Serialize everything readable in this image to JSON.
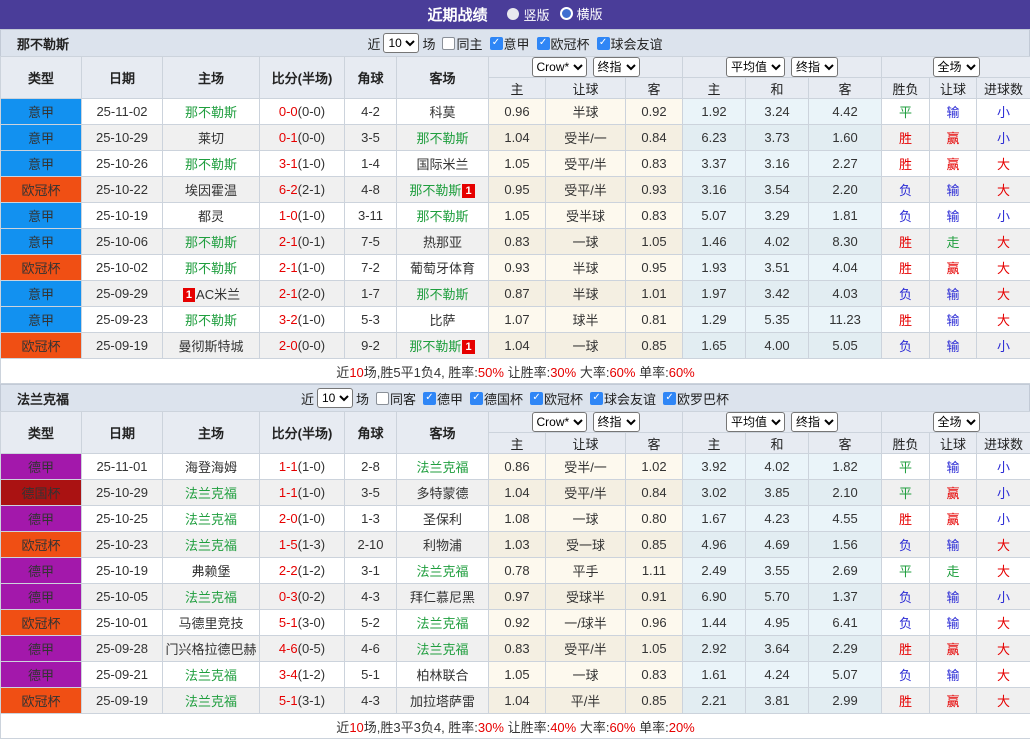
{
  "title_bar": {
    "title": "近期战绩",
    "options": [
      {
        "label": "竖版",
        "selected": true
      },
      {
        "label": "横版",
        "selected": false
      }
    ]
  },
  "league_colors": {
    "意甲": "#1291f0",
    "欧冠杯": "#f04f14",
    "德甲": "#a318ab",
    "德国杯": "#aa1212"
  },
  "result_colors": {
    "r": "#e60000",
    "b": "#2b2bd5",
    "g": "#1f9e3e",
    "d": "#333333"
  },
  "table_header": {
    "static_cols": [
      "类型",
      "日期",
      "主场",
      "比分(半场)",
      "角球",
      "客场"
    ],
    "group1": {
      "select1": "Crow*",
      "select2": "终指"
    },
    "group2": {
      "select1": "平均值",
      "select2": "终指"
    },
    "group3": {
      "select": "全场"
    },
    "sub_cols": [
      "主",
      "让球",
      "客",
      "主",
      "和",
      "客",
      "胜负",
      "让球",
      "进球数"
    ]
  },
  "sections": [
    {
      "team": "那不勒斯",
      "filter": {
        "prefix": "近",
        "games": "10",
        "suffix": "场",
        "same": {
          "label": "同主",
          "checked": false
        },
        "leagues": [
          {
            "label": "意甲",
            "checked": true
          },
          {
            "label": "欧冠杯",
            "checked": true
          },
          {
            "label": "球会友谊",
            "checked": true
          }
        ]
      },
      "rows": [
        {
          "type": "意甲",
          "date": "25-11-02",
          "home": "那不勒斯",
          "home_hl": true,
          "home_badge": "",
          "score": "0-0",
          "half": "(0-0)",
          "corner": "4-2",
          "away": "科莫",
          "away_hl": false,
          "away_badge": "",
          "o1": "0.96",
          "o2": "半球",
          "o3": "0.92",
          "a1": "1.92",
          "a2": "3.24",
          "a3": "4.42",
          "r1": {
            "t": "平",
            "c": "g"
          },
          "r2": {
            "t": "输",
            "c": "b"
          },
          "r3": {
            "t": "小",
            "c": "b"
          }
        },
        {
          "type": "意甲",
          "date": "25-10-29",
          "home": "莱切",
          "home_hl": false,
          "home_badge": "",
          "score": "0-1",
          "half": "(0-0)",
          "corner": "3-5",
          "away": "那不勒斯",
          "away_hl": true,
          "away_badge": "",
          "o1": "1.04",
          "o2": "受半/一",
          "o3": "0.84",
          "a1": "6.23",
          "a2": "3.73",
          "a3": "1.60",
          "r1": {
            "t": "胜",
            "c": "r"
          },
          "r2": {
            "t": "赢",
            "c": "r"
          },
          "r3": {
            "t": "小",
            "c": "b"
          }
        },
        {
          "type": "意甲",
          "date": "25-10-26",
          "home": "那不勒斯",
          "home_hl": true,
          "home_badge": "",
          "score": "3-1",
          "half": "(1-0)",
          "corner": "1-4",
          "away": "国际米兰",
          "away_hl": false,
          "away_badge": "",
          "o1": "1.05",
          "o2": "受平/半",
          "o3": "0.83",
          "a1": "3.37",
          "a2": "3.16",
          "a3": "2.27",
          "r1": {
            "t": "胜",
            "c": "r"
          },
          "r2": {
            "t": "赢",
            "c": "r"
          },
          "r3": {
            "t": "大",
            "c": "r"
          }
        },
        {
          "type": "欧冠杯",
          "date": "25-10-22",
          "home": "埃因霍温",
          "home_hl": false,
          "home_badge": "",
          "score": "6-2",
          "half": "(2-1)",
          "corner": "4-8",
          "away": "那不勒斯",
          "away_hl": true,
          "away_badge": "1",
          "o1": "0.95",
          "o2": "受平/半",
          "o3": "0.93",
          "a1": "3.16",
          "a2": "3.54",
          "a3": "2.20",
          "r1": {
            "t": "负",
            "c": "b"
          },
          "r2": {
            "t": "输",
            "c": "b"
          },
          "r3": {
            "t": "大",
            "c": "r"
          }
        },
        {
          "type": "意甲",
          "date": "25-10-19",
          "home": "都灵",
          "home_hl": false,
          "home_badge": "",
          "score": "1-0",
          "half": "(1-0)",
          "corner": "3-11",
          "away": "那不勒斯",
          "away_hl": true,
          "away_badge": "",
          "o1": "1.05",
          "o2": "受半球",
          "o3": "0.83",
          "a1": "5.07",
          "a2": "3.29",
          "a3": "1.81",
          "r1": {
            "t": "负",
            "c": "b"
          },
          "r2": {
            "t": "输",
            "c": "b"
          },
          "r3": {
            "t": "小",
            "c": "b"
          }
        },
        {
          "type": "意甲",
          "date": "25-10-06",
          "home": "那不勒斯",
          "home_hl": true,
          "home_badge": "",
          "score": "2-1",
          "half": "(0-1)",
          "corner": "7-5",
          "away": "热那亚",
          "away_hl": false,
          "away_badge": "",
          "o1": "0.83",
          "o2": "一球",
          "o3": "1.05",
          "a1": "1.46",
          "a2": "4.02",
          "a3": "8.30",
          "r1": {
            "t": "胜",
            "c": "r"
          },
          "r2": {
            "t": "走",
            "c": "g"
          },
          "r3": {
            "t": "大",
            "c": "r"
          }
        },
        {
          "type": "欧冠杯",
          "date": "25-10-02",
          "home": "那不勒斯",
          "home_hl": true,
          "home_badge": "",
          "score": "2-1",
          "half": "(1-0)",
          "corner": "7-2",
          "away": "葡萄牙体育",
          "away_hl": false,
          "away_badge": "",
          "o1": "0.93",
          "o2": "半球",
          "o3": "0.95",
          "a1": "1.93",
          "a2": "3.51",
          "a3": "4.04",
          "r1": {
            "t": "胜",
            "c": "r"
          },
          "r2": {
            "t": "赢",
            "c": "r"
          },
          "r3": {
            "t": "大",
            "c": "r"
          }
        },
        {
          "type": "意甲",
          "date": "25-09-29",
          "home": "AC米兰",
          "home_hl": false,
          "home_badge": "1",
          "score": "2-1",
          "half": "(2-0)",
          "corner": "1-7",
          "away": "那不勒斯",
          "away_hl": true,
          "away_badge": "",
          "o1": "0.87",
          "o2": "半球",
          "o3": "1.01",
          "a1": "1.97",
          "a2": "3.42",
          "a3": "4.03",
          "r1": {
            "t": "负",
            "c": "b"
          },
          "r2": {
            "t": "输",
            "c": "b"
          },
          "r3": {
            "t": "大",
            "c": "r"
          }
        },
        {
          "type": "意甲",
          "date": "25-09-23",
          "home": "那不勒斯",
          "home_hl": true,
          "home_badge": "",
          "score": "3-2",
          "half": "(1-0)",
          "corner": "5-3",
          "away": "比萨",
          "away_hl": false,
          "away_badge": "",
          "o1": "1.07",
          "o2": "球半",
          "o3": "0.81",
          "a1": "1.29",
          "a2": "5.35",
          "a3": "11.23",
          "r1": {
            "t": "胜",
            "c": "r"
          },
          "r2": {
            "t": "输",
            "c": "b"
          },
          "r3": {
            "t": "大",
            "c": "r"
          }
        },
        {
          "type": "欧冠杯",
          "date": "25-09-19",
          "home": "曼彻斯特城",
          "home_hl": false,
          "home_badge": "",
          "score": "2-0",
          "half": "(0-0)",
          "corner": "9-2",
          "away": "那不勒斯",
          "away_hl": true,
          "away_badge": "1",
          "o1": "1.04",
          "o2": "一球",
          "o3": "0.85",
          "a1": "1.65",
          "a2": "4.00",
          "a3": "5.05",
          "r1": {
            "t": "负",
            "c": "b"
          },
          "r2": {
            "t": "输",
            "c": "b"
          },
          "r3": {
            "t": "小",
            "c": "b"
          }
        }
      ],
      "summary": [
        {
          "t": "近",
          "c": "d"
        },
        {
          "t": "10",
          "c": "r"
        },
        {
          "t": "场,胜5平1负4, 胜率:",
          "c": "d"
        },
        {
          "t": "50%",
          "c": "r"
        },
        {
          "t": " 让胜率:",
          "c": "d"
        },
        {
          "t": "30%",
          "c": "r"
        },
        {
          "t": " 大率:",
          "c": "d"
        },
        {
          "t": "60%",
          "c": "r"
        },
        {
          "t": " 单率:",
          "c": "d"
        },
        {
          "t": "60%",
          "c": "r"
        }
      ]
    },
    {
      "team": "法兰克福",
      "filter": {
        "prefix": "近",
        "games": "10",
        "suffix": "场",
        "same": {
          "label": "同客",
          "checked": false
        },
        "leagues": [
          {
            "label": "德甲",
            "checked": true
          },
          {
            "label": "德国杯",
            "checked": true
          },
          {
            "label": "欧冠杯",
            "checked": true
          },
          {
            "label": "球会友谊",
            "checked": true
          },
          {
            "label": "欧罗巴杯",
            "checked": true
          }
        ]
      },
      "rows": [
        {
          "type": "德甲",
          "date": "25-11-01",
          "home": "海登海姆",
          "home_hl": false,
          "home_badge": "",
          "score": "1-1",
          "half": "(1-0)",
          "corner": "2-8",
          "away": "法兰克福",
          "away_hl": true,
          "away_badge": "",
          "o1": "0.86",
          "o2": "受半/一",
          "o3": "1.02",
          "a1": "3.92",
          "a2": "4.02",
          "a3": "1.82",
          "r1": {
            "t": "平",
            "c": "g"
          },
          "r2": {
            "t": "输",
            "c": "b"
          },
          "r3": {
            "t": "小",
            "c": "b"
          }
        },
        {
          "type": "德国杯",
          "date": "25-10-29",
          "home": "法兰克福",
          "home_hl": true,
          "home_badge": "",
          "score": "1-1",
          "half": "(1-0)",
          "corner": "3-5",
          "away": "多特蒙德",
          "away_hl": false,
          "away_badge": "",
          "o1": "1.04",
          "o2": "受平/半",
          "o3": "0.84",
          "a1": "3.02",
          "a2": "3.85",
          "a3": "2.10",
          "r1": {
            "t": "平",
            "c": "g"
          },
          "r2": {
            "t": "赢",
            "c": "r"
          },
          "r3": {
            "t": "小",
            "c": "b"
          }
        },
        {
          "type": "德甲",
          "date": "25-10-25",
          "home": "法兰克福",
          "home_hl": true,
          "home_badge": "",
          "score": "2-0",
          "half": "(1-0)",
          "corner": "1-3",
          "away": "圣保利",
          "away_hl": false,
          "away_badge": "",
          "o1": "1.08",
          "o2": "一球",
          "o3": "0.80",
          "a1": "1.67",
          "a2": "4.23",
          "a3": "4.55",
          "r1": {
            "t": "胜",
            "c": "r"
          },
          "r2": {
            "t": "赢",
            "c": "r"
          },
          "r3": {
            "t": "小",
            "c": "b"
          }
        },
        {
          "type": "欧冠杯",
          "date": "25-10-23",
          "home": "法兰克福",
          "home_hl": true,
          "home_badge": "",
          "score": "1-5",
          "half": "(1-3)",
          "corner": "2-10",
          "away": "利物浦",
          "away_hl": false,
          "away_badge": "",
          "o1": "1.03",
          "o2": "受一球",
          "o3": "0.85",
          "a1": "4.96",
          "a2": "4.69",
          "a3": "1.56",
          "r1": {
            "t": "负",
            "c": "b"
          },
          "r2": {
            "t": "输",
            "c": "b"
          },
          "r3": {
            "t": "大",
            "c": "r"
          }
        },
        {
          "type": "德甲",
          "date": "25-10-19",
          "home": "弗赖堡",
          "home_hl": false,
          "home_badge": "",
          "score": "2-2",
          "half": "(1-2)",
          "corner": "3-1",
          "away": "法兰克福",
          "away_hl": true,
          "away_badge": "",
          "o1": "0.78",
          "o2": "平手",
          "o3": "1.11",
          "a1": "2.49",
          "a2": "3.55",
          "a3": "2.69",
          "r1": {
            "t": "平",
            "c": "g"
          },
          "r2": {
            "t": "走",
            "c": "g"
          },
          "r3": {
            "t": "大",
            "c": "r"
          }
        },
        {
          "type": "德甲",
          "date": "25-10-05",
          "home": "法兰克福",
          "home_hl": true,
          "home_badge": "",
          "score": "0-3",
          "half": "(0-2)",
          "corner": "4-3",
          "away": "拜仁慕尼黑",
          "away_hl": false,
          "away_badge": "",
          "o1": "0.97",
          "o2": "受球半",
          "o3": "0.91",
          "a1": "6.90",
          "a2": "5.70",
          "a3": "1.37",
          "r1": {
            "t": "负",
            "c": "b"
          },
          "r2": {
            "t": "输",
            "c": "b"
          },
          "r3": {
            "t": "小",
            "c": "b"
          }
        },
        {
          "type": "欧冠杯",
          "date": "25-10-01",
          "home": "马德里竞技",
          "home_hl": false,
          "home_badge": "",
          "score": "5-1",
          "half": "(3-0)",
          "corner": "5-2",
          "away": "法兰克福",
          "away_hl": true,
          "away_badge": "",
          "o1": "0.92",
          "o2": "一/球半",
          "o3": "0.96",
          "a1": "1.44",
          "a2": "4.95",
          "a3": "6.41",
          "r1": {
            "t": "负",
            "c": "b"
          },
          "r2": {
            "t": "输",
            "c": "b"
          },
          "r3": {
            "t": "大",
            "c": "r"
          }
        },
        {
          "type": "德甲",
          "date": "25-09-28",
          "home": "门兴格拉德巴赫",
          "home_hl": false,
          "home_badge": "",
          "score": "4-6",
          "half": "(0-5)",
          "corner": "4-6",
          "away": "法兰克福",
          "away_hl": true,
          "away_badge": "",
          "o1": "0.83",
          "o2": "受平/半",
          "o3": "1.05",
          "a1": "2.92",
          "a2": "3.64",
          "a3": "2.29",
          "r1": {
            "t": "胜",
            "c": "r"
          },
          "r2": {
            "t": "赢",
            "c": "r"
          },
          "r3": {
            "t": "大",
            "c": "r"
          }
        },
        {
          "type": "德甲",
          "date": "25-09-21",
          "home": "法兰克福",
          "home_hl": true,
          "home_badge": "",
          "score": "3-4",
          "half": "(1-2)",
          "corner": "5-1",
          "away": "柏林联合",
          "away_hl": false,
          "away_badge": "",
          "o1": "1.05",
          "o2": "一球",
          "o3": "0.83",
          "a1": "1.61",
          "a2": "4.24",
          "a3": "5.07",
          "r1": {
            "t": "负",
            "c": "b"
          },
          "r2": {
            "t": "输",
            "c": "b"
          },
          "r3": {
            "t": "大",
            "c": "r"
          }
        },
        {
          "type": "欧冠杯",
          "date": "25-09-19",
          "home": "法兰克福",
          "home_hl": true,
          "home_badge": "",
          "score": "5-1",
          "half": "(3-1)",
          "corner": "4-3",
          "away": "加拉塔萨雷",
          "away_hl": false,
          "away_badge": "",
          "o1": "1.04",
          "o2": "平/半",
          "o3": "0.85",
          "a1": "2.21",
          "a2": "3.81",
          "a3": "2.99",
          "r1": {
            "t": "胜",
            "c": "r"
          },
          "r2": {
            "t": "赢",
            "c": "r"
          },
          "r3": {
            "t": "大",
            "c": "r"
          }
        }
      ],
      "summary": [
        {
          "t": "近",
          "c": "d"
        },
        {
          "t": "10",
          "c": "r"
        },
        {
          "t": "场,胜3平3负4, 胜率:",
          "c": "d"
        },
        {
          "t": "30%",
          "c": "r"
        },
        {
          "t": " 让胜率:",
          "c": "d"
        },
        {
          "t": "40%",
          "c": "r"
        },
        {
          "t": " 大率:",
          "c": "d"
        },
        {
          "t": "60%",
          "c": "r"
        },
        {
          "t": " 单率:",
          "c": "d"
        },
        {
          "t": "20%",
          "c": "r"
        }
      ]
    }
  ]
}
